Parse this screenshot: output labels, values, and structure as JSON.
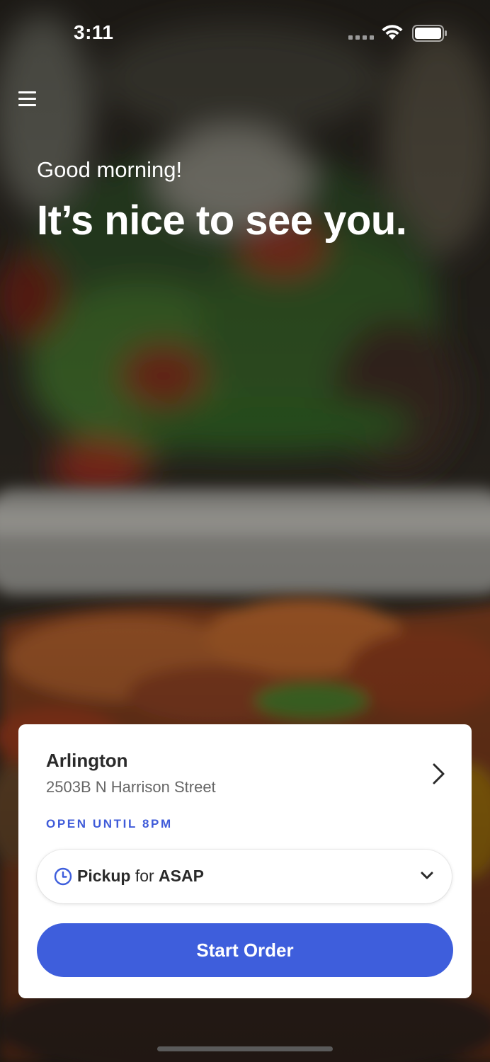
{
  "status_bar": {
    "time": "3:11"
  },
  "hero": {
    "greeting": "Good morning!",
    "headline": "It’s nice to see you."
  },
  "location_card": {
    "name": "Arlington",
    "address": "2503B N Harrison Street",
    "hours": "OPEN UNTIL 8PM",
    "order_type": "Pickup",
    "order_for": "for",
    "order_time": "ASAP",
    "start_button": "Start Order"
  },
  "colors": {
    "accent": "#3e5edc",
    "hours_text": "#3f5bd9",
    "card_background": "#ffffff"
  },
  "icons": {
    "menu": "hamburger-menu-icon",
    "chevron": "chevron-right-icon",
    "clock": "clock-icon",
    "dropdown": "chevron-down-icon"
  }
}
